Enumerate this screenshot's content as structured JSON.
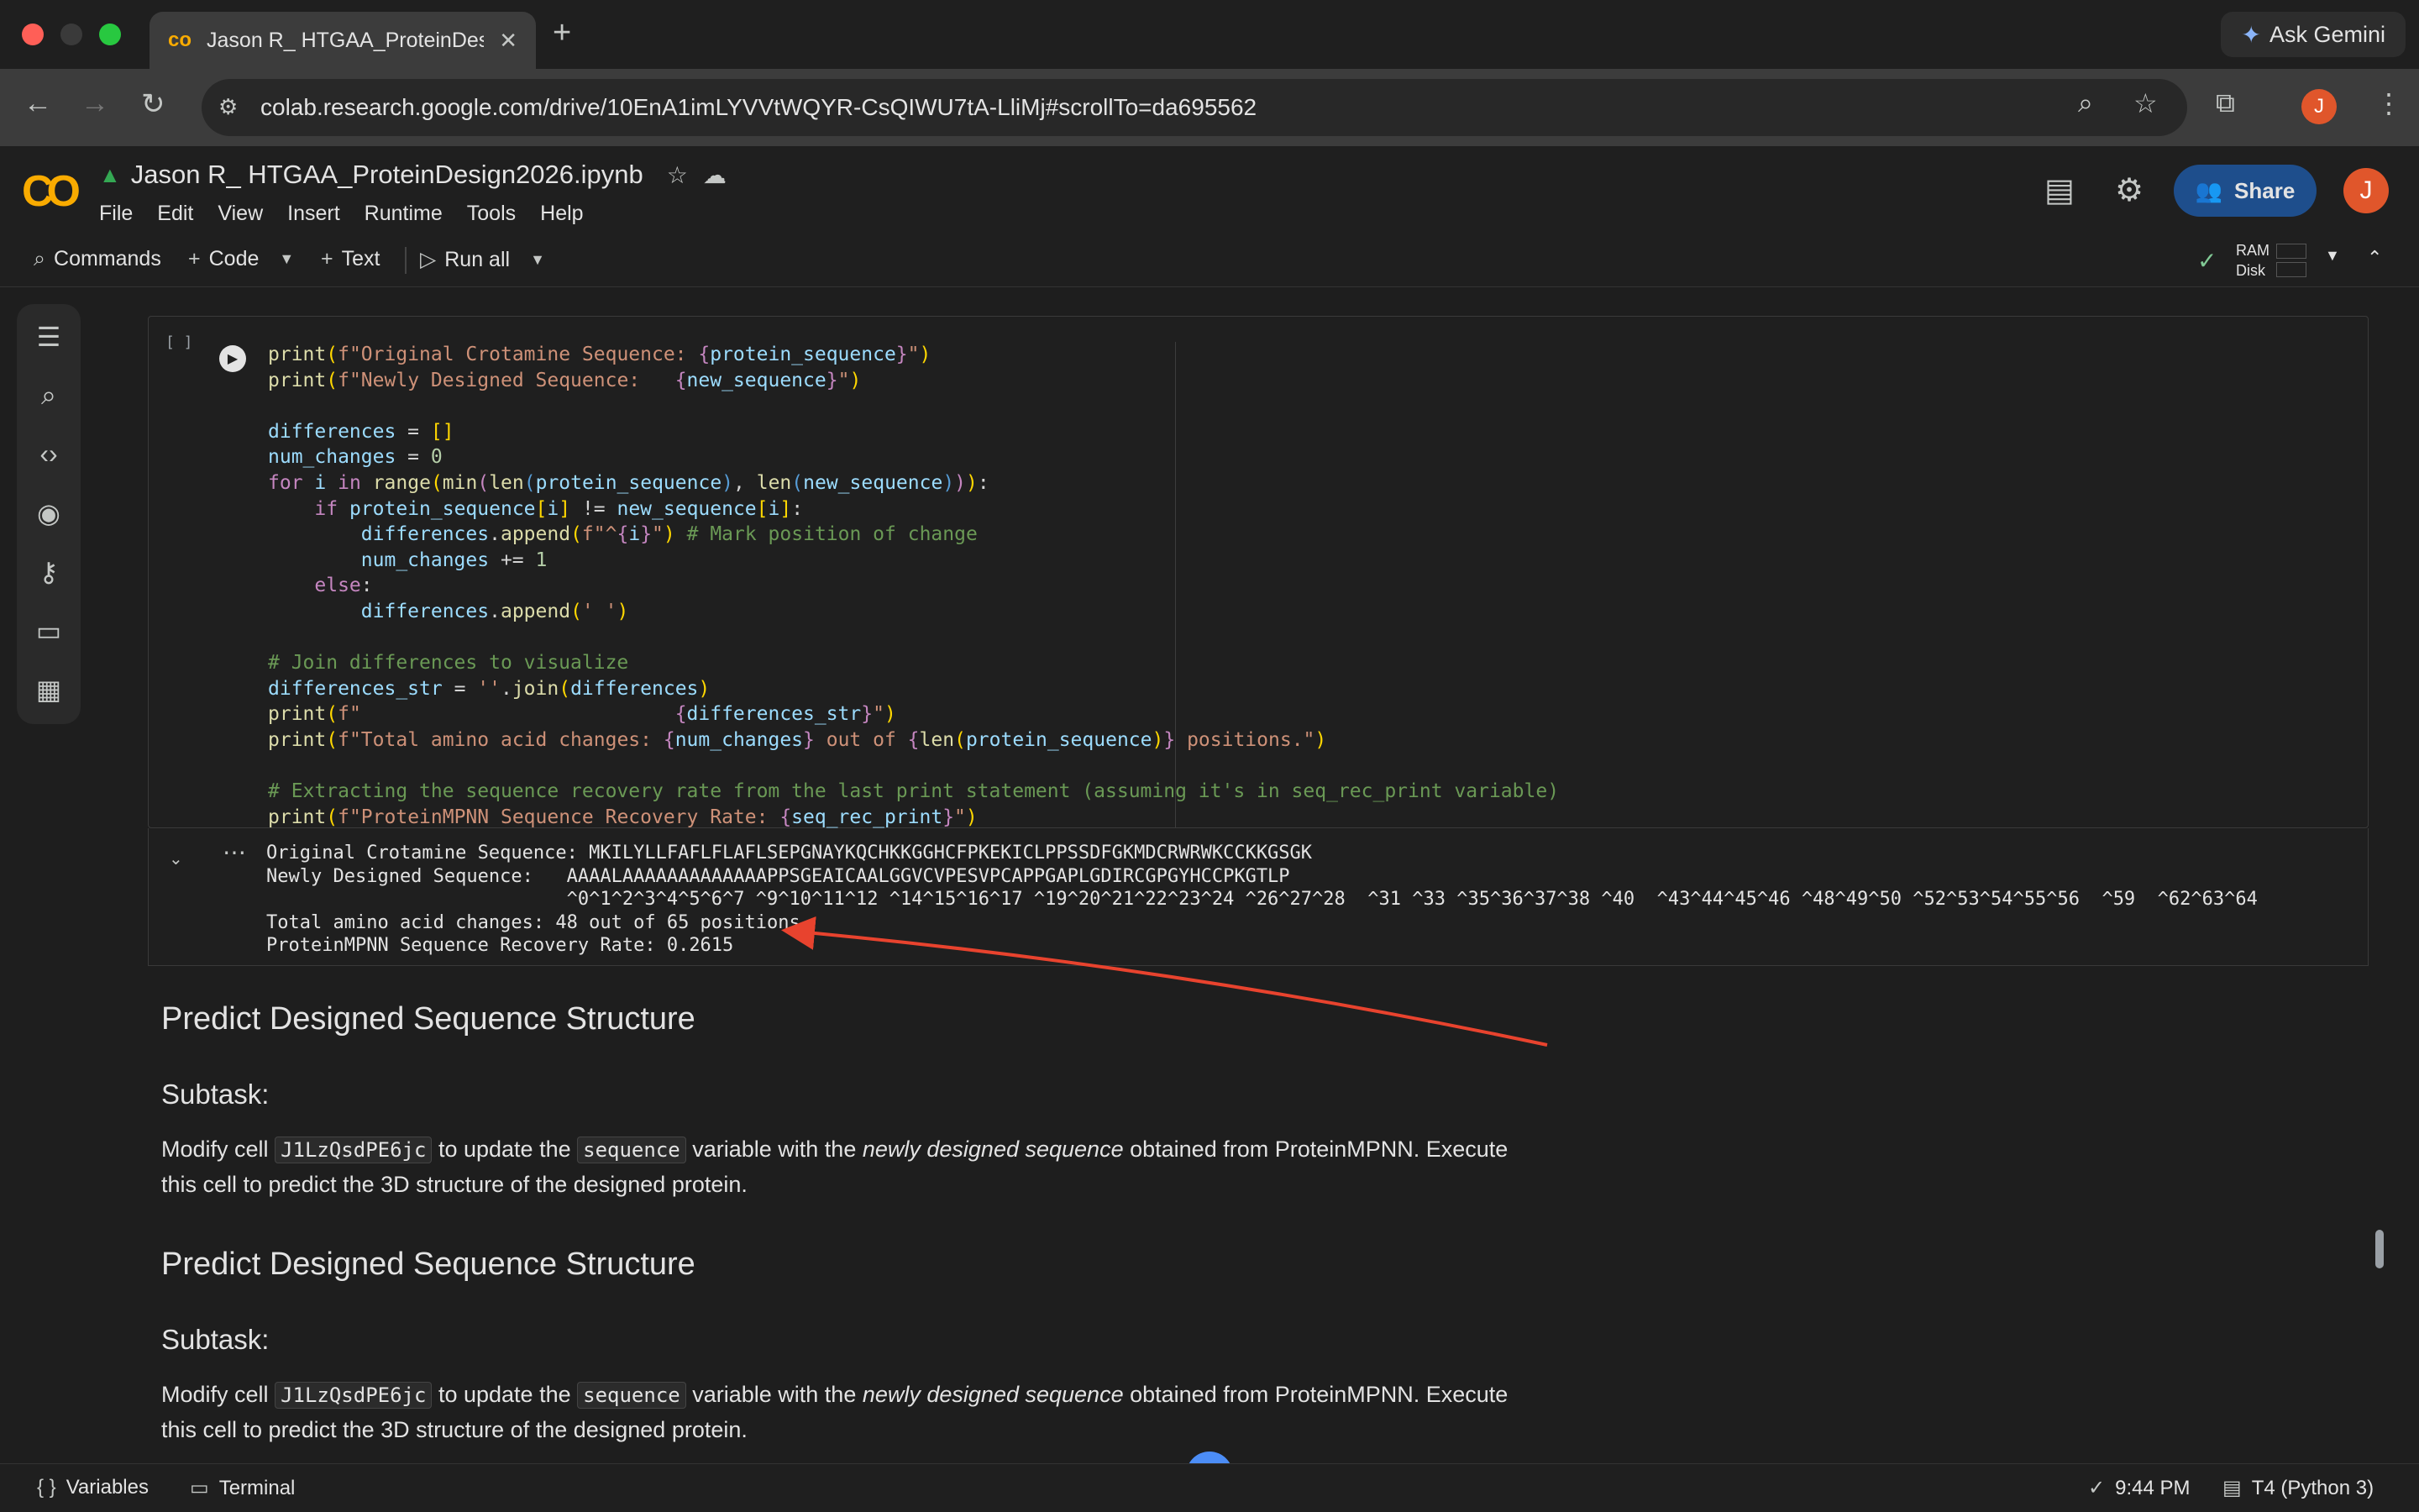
{
  "browser": {
    "tab_title": "Jason R_ HTGAA_ProteinDesign",
    "url": "colab.research.google.com/drive/10EnA1imLYVVtWQYR-CsQIWU7tA-LliMj#scrollTo=da695562",
    "ask_gemini": "Ask Gemini",
    "profile_initial": "J"
  },
  "colab": {
    "logo": "CO",
    "notebook_title": "Jason R_ HTGAA_ProteinDesign2026.ipynb",
    "menu": [
      "File",
      "Edit",
      "View",
      "Insert",
      "Runtime",
      "Tools",
      "Help"
    ],
    "share_label": "Share",
    "avatar_initial": "J"
  },
  "commandbar": {
    "commands": "Commands",
    "code": "Code",
    "text": "Text",
    "run_all": "Run all",
    "ram": "RAM",
    "disk": "Disk"
  },
  "cell": {
    "bracket": "[ ]"
  },
  "output": {
    "line1": "Original Crotamine Sequence: MKILYLLFAFLFLAFLSEPGNAYKQCHKKGGHCFPKEKICLPPSSDFGKMDCRWRWKCCKKGSGK",
    "line2": "Newly Designed Sequence:   AAAALAAAAAAAAAAAAAPPSGEAICAALGGVCVPESVPCAPPGAPLGDIRCGPGYHCCPKGTLP",
    "line3": "                           ^0^1^2^3^4^5^6^7 ^9^10^11^12 ^14^15^16^17 ^19^20^21^22^23^24 ^26^27^28  ^31 ^33 ^35^36^37^38 ^40  ^43^44^45^46 ^48^49^50 ^52^53^54^55^56  ^59  ^62^63^64",
    "line4": "Total amino acid changes: 48 out of 65 positions.",
    "line5": "ProteinMPNN Sequence Recovery Rate: 0.2615"
  },
  "markdown": {
    "section1_title": "Predict Designed Sequence Structure",
    "section1_subtask": "Subtask:",
    "section2_title": "Predict Designed Sequence Structure",
    "section2_subtask": "Subtask:",
    "para_modify": "Modify cell",
    "para_cell_id": "J1LzQsdPE6jc",
    "para_to_update": "to update the",
    "para_var": "sequence",
    "para_variable_with": "variable with the",
    "para_em": "newly designed sequence",
    "para_rest": "obtained from ProteinMPNN. Execute",
    "para_line2": "this cell to predict the 3D structure of the designed protein."
  },
  "statusbar": {
    "variables": "Variables",
    "terminal": "Terminal",
    "time": "9:44 PM",
    "runtime": "T4 (Python 3)"
  }
}
